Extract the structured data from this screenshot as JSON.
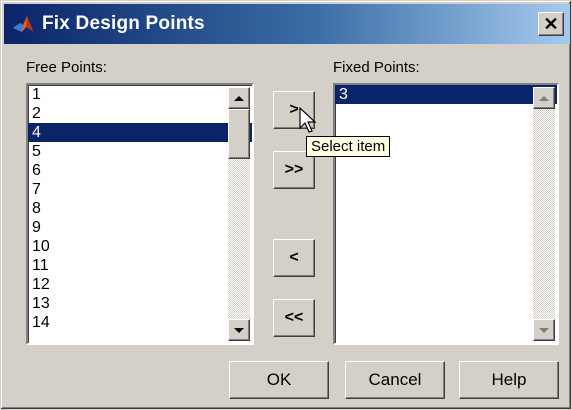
{
  "window": {
    "title": "Fix Design Points",
    "close_glyph": "✕"
  },
  "free_points": {
    "label": "Free Points:",
    "items": [
      "1",
      "2",
      "4",
      "5",
      "6",
      "7",
      "8",
      "9",
      "10",
      "11",
      "12",
      "13",
      "14"
    ],
    "selected": "4"
  },
  "fixed_points": {
    "label": "Fixed Points:",
    "items": [
      "3"
    ],
    "selected": "3"
  },
  "transfer_buttons": {
    "add_one": ">",
    "add_all": ">>",
    "remove_one": "<",
    "remove_all": "<<"
  },
  "tooltip": "Select item",
  "footer": {
    "ok": "OK",
    "cancel": "Cancel",
    "help": "Help"
  },
  "icons": {
    "title": "matlab-logo-icon",
    "close": "close-icon",
    "scroll_up": "scroll-up-icon",
    "scroll_down": "scroll-down-icon",
    "cursor": "mouse-pointer-icon"
  },
  "colors": {
    "title_start": "#0a246a",
    "title_end": "#a6caf0",
    "selection": "#0a246a",
    "face": "#d4d0c8",
    "tooltip": "#ffffe1"
  }
}
